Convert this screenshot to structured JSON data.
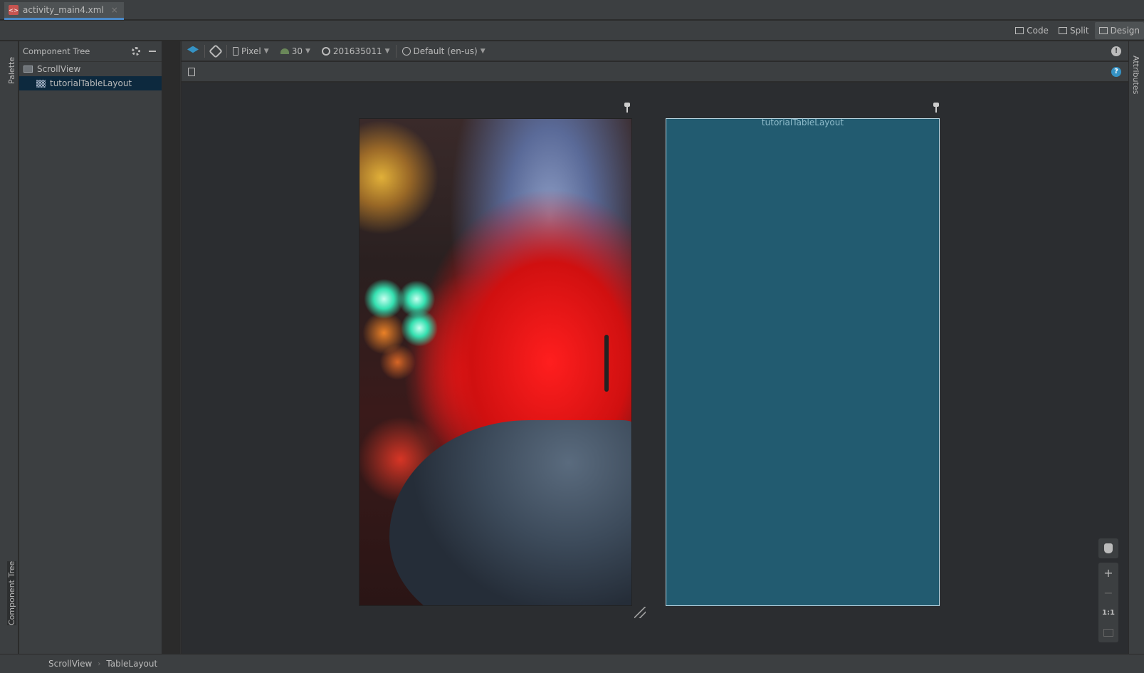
{
  "tab": {
    "file": "activity_main4.xml"
  },
  "modes": {
    "code": "Code",
    "split": "Split",
    "design": "Design"
  },
  "left_strip": {
    "palette": "Palette",
    "component_tree": "Component Tree"
  },
  "right_strip": {
    "attributes": "Attributes"
  },
  "component_tree": {
    "title": "Component Tree",
    "items": [
      {
        "label": "ScrollView",
        "selected": false
      },
      {
        "label": "tutorialTableLayout",
        "selected": true
      }
    ]
  },
  "toolbar": {
    "device": "Pixel",
    "api": "30",
    "theme": "201635011",
    "locale": "Default (en-us)"
  },
  "blueprint": {
    "label": "tutorialTableLayout"
  },
  "zoom": {
    "one_to_one": "1:1"
  },
  "breadcrumb": [
    "ScrollView",
    "TableLayout"
  ],
  "colors": {
    "accent": "#4a88c7",
    "blueprint_bg": "#225b70",
    "selection": "#0d293e"
  }
}
